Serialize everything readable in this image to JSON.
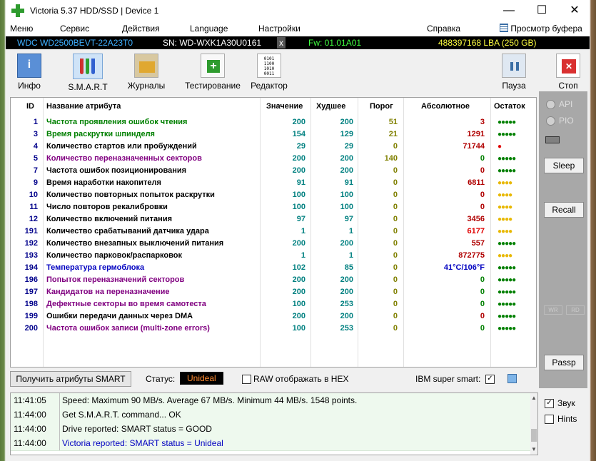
{
  "window": {
    "title": "Victoria 5.37 HDD/SSD | Device 1",
    "minimize": "—",
    "maximize": "☐",
    "close": "✕"
  },
  "menu": {
    "items": [
      "Меню",
      "Сервис",
      "Действия",
      "Language",
      "Настройки",
      "Справка"
    ],
    "buffer_view": "Просмотр буфера"
  },
  "device": {
    "model": "WDC WD2500BEVT-22A23T0",
    "serial": "SN: WD-WXK1A30U0161",
    "serial_close": "x",
    "firmware": "Fw: 01.01A01",
    "capacity": "488397168 LBA (250 GB)"
  },
  "toolbar": {
    "info": "Инфо",
    "smart": "S.M.A.R.T",
    "logs": "Журналы",
    "test": "Тестирование",
    "editor": "Редактор",
    "pause": "Пауза",
    "stop": "Стоп"
  },
  "table": {
    "headers": {
      "id": "ID",
      "name": "Название атрибута",
      "value": "Значение",
      "worst": "Худшее",
      "threshold": "Порог",
      "absolute": "Абсолютное",
      "remain": "Остаток"
    },
    "rows": [
      {
        "id": "1",
        "name": "Частота проявления ошибок чтения",
        "value": "200",
        "worst": "200",
        "threshold": "51",
        "absolute": "3",
        "remain": "●●●●●",
        "nameColor": "#008000",
        "absColor": "#b00000",
        "remainColor": "#008000"
      },
      {
        "id": "3",
        "name": "Время раскрутки шпинделя",
        "value": "154",
        "worst": "129",
        "threshold": "21",
        "absolute": "1291",
        "remain": "●●●●●",
        "nameColor": "#008000",
        "absColor": "#b00000",
        "remainColor": "#008000"
      },
      {
        "id": "4",
        "name": "Количество стартов или пробуждений",
        "value": "29",
        "worst": "29",
        "threshold": "0",
        "absolute": "71744",
        "remain": "●",
        "nameColor": "#000000",
        "absColor": "#b00000",
        "remainColor": "#e00000"
      },
      {
        "id": "5",
        "name": "Количество переназначенных секторов",
        "value": "200",
        "worst": "200",
        "threshold": "140",
        "absolute": "0",
        "remain": "●●●●●",
        "nameColor": "#800080",
        "absColor": "#008000",
        "remainColor": "#008000"
      },
      {
        "id": "7",
        "name": "Частота ошибок позиционирования",
        "value": "200",
        "worst": "200",
        "threshold": "0",
        "absolute": "0",
        "remain": "●●●●●",
        "nameColor": "#000000",
        "absColor": "#b00000",
        "remainColor": "#008000"
      },
      {
        "id": "9",
        "name": "Время наработки накопителя",
        "value": "91",
        "worst": "91",
        "threshold": "0",
        "absolute": "6811",
        "remain": "●●●●",
        "nameColor": "#000000",
        "absColor": "#b00000",
        "remainColor": "#e8b800"
      },
      {
        "id": "10",
        "name": "Количество повторных попыток раскрутки",
        "value": "100",
        "worst": "100",
        "threshold": "0",
        "absolute": "0",
        "remain": "●●●●",
        "nameColor": "#000000",
        "absColor": "#b00000",
        "remainColor": "#e8b800"
      },
      {
        "id": "11",
        "name": "Число повторов рекалибровки",
        "value": "100",
        "worst": "100",
        "threshold": "0",
        "absolute": "0",
        "remain": "●●●●",
        "nameColor": "#000000",
        "absColor": "#b00000",
        "remainColor": "#e8b800"
      },
      {
        "id": "12",
        "name": "Количество включений питания",
        "value": "97",
        "worst": "97",
        "threshold": "0",
        "absolute": "3456",
        "remain": "●●●●",
        "nameColor": "#000000",
        "absColor": "#b00000",
        "remainColor": "#e8b800"
      },
      {
        "id": "191",
        "name": "Количество срабатываний датчика удара",
        "value": "1",
        "worst": "1",
        "threshold": "0",
        "absolute": "6177",
        "remain": "●●●●",
        "nameColor": "#000000",
        "absColor": "#e00000",
        "remainColor": "#e8b800"
      },
      {
        "id": "192",
        "name": "Количество внезапных выключений питания",
        "value": "200",
        "worst": "200",
        "threshold": "0",
        "absolute": "557",
        "remain": "●●●●●",
        "nameColor": "#000000",
        "absColor": "#b00000",
        "remainColor": "#008000"
      },
      {
        "id": "193",
        "name": "Количество парковок/распарковок",
        "value": "1",
        "worst": "1",
        "threshold": "0",
        "absolute": "872775",
        "remain": "●●●●",
        "nameColor": "#000000",
        "absColor": "#b00000",
        "remainColor": "#e8b800"
      },
      {
        "id": "194",
        "name": "Температура гермоблока",
        "value": "102",
        "worst": "85",
        "threshold": "0",
        "absolute": "41°C/106°F",
        "remain": "●●●●●",
        "nameColor": "#0000c0",
        "absColor": "#0000c0",
        "remainColor": "#008000"
      },
      {
        "id": "196",
        "name": "Попыток переназначений секторов",
        "value": "200",
        "worst": "200",
        "threshold": "0",
        "absolute": "0",
        "remain": "●●●●●",
        "nameColor": "#800080",
        "absColor": "#008000",
        "remainColor": "#008000"
      },
      {
        "id": "197",
        "name": "Кандидатов на переназначение",
        "value": "200",
        "worst": "200",
        "threshold": "0",
        "absolute": "0",
        "remain": "●●●●●",
        "nameColor": "#800080",
        "absColor": "#008000",
        "remainColor": "#008000"
      },
      {
        "id": "198",
        "name": "Дефектные секторы во время самотеста",
        "value": "100",
        "worst": "253",
        "threshold": "0",
        "absolute": "0",
        "remain": "●●●●●",
        "nameColor": "#800080",
        "absColor": "#008000",
        "remainColor": "#008000"
      },
      {
        "id": "199",
        "name": "Ошибки передачи данных через DMA",
        "value": "200",
        "worst": "200",
        "threshold": "0",
        "absolute": "0",
        "remain": "●●●●●",
        "nameColor": "#000000",
        "absColor": "#b00000",
        "remainColor": "#008000"
      },
      {
        "id": "200",
        "name": "Частота ошибок записи (multi-zone errors)",
        "value": "100",
        "worst": "253",
        "threshold": "0",
        "absolute": "0",
        "remain": "●●●●●",
        "nameColor": "#800080",
        "absColor": "#008000",
        "remainColor": "#008000"
      }
    ]
  },
  "status": {
    "get_smart_button": "Получить атрибуты SMART",
    "label": "Статус:",
    "value": "Unideal",
    "raw_hex": "RAW отображать в HEX",
    "ibm": "IBM super smart:"
  },
  "right_panel": {
    "api": "API",
    "pio": "PIO",
    "sleep": "Sleep",
    "recall": "Recall",
    "wr": "WR",
    "rd": "RD",
    "passp": "Passp",
    "sound": "Звук",
    "hints": "Hints"
  },
  "log": [
    {
      "time": "11:41:05",
      "msg": "Speed: Maximum 90 MB/s. Average 67 MB/s. Minimum 44 MB/s. 1548 points.",
      "color": "#000000"
    },
    {
      "time": "11:44:00",
      "msg": "Get S.M.A.R.T. command... OK",
      "color": "#000000"
    },
    {
      "time": "11:44:00",
      "msg": "Drive reported: SMART status = GOOD",
      "color": "#000000"
    },
    {
      "time": "11:44:00",
      "msg": "Victoria reported: SMART status = Unideal",
      "color": "#0000c0"
    }
  ]
}
